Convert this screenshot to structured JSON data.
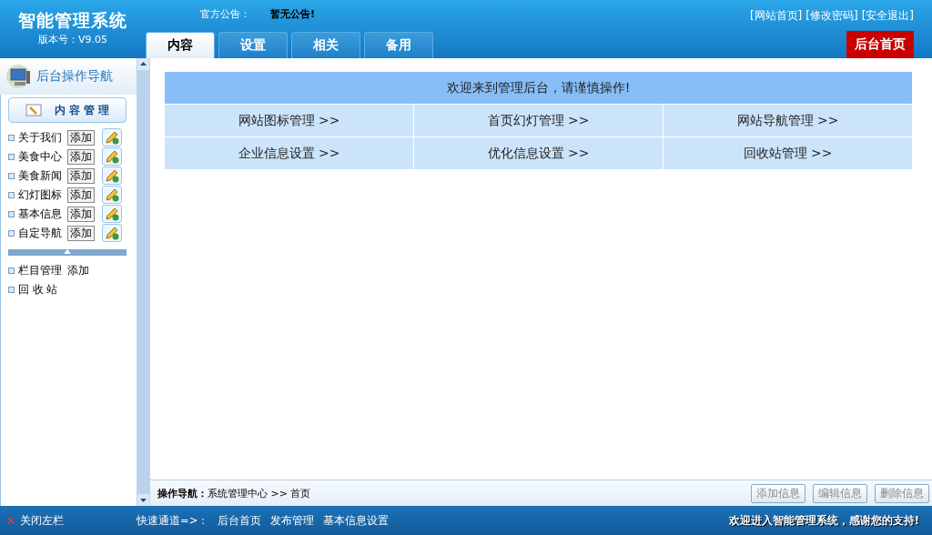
{
  "header": {
    "title": "智能管理系统",
    "version": "版本号：V9.05",
    "notice_label": "官方公告：",
    "notice": "暂无公告!",
    "links": [
      "[网站首页]",
      "[修改密码]",
      "[安全退出]"
    ],
    "home_button": "后台首页"
  },
  "tabs": [
    {
      "label": "内容",
      "selected": true
    },
    {
      "label": "设置",
      "selected": false
    },
    {
      "label": "相关",
      "selected": false
    },
    {
      "label": "备用",
      "selected": false
    }
  ],
  "sidebar": {
    "title": "后台操作导航",
    "section": "内 容 管 理",
    "items": [
      {
        "label": "关于我们",
        "action": "添加"
      },
      {
        "label": "美食中心",
        "action": "添加"
      },
      {
        "label": "美食新闻",
        "action": "添加"
      },
      {
        "label": "幻灯图标",
        "action": "添加"
      },
      {
        "label": "基本信息",
        "action": "添加"
      },
      {
        "label": "自定导航",
        "action": "添加"
      }
    ],
    "extra_items": [
      {
        "label": "栏目管理",
        "action": "添加"
      },
      {
        "label": "回 收 站"
      }
    ]
  },
  "welcome": "欢迎来到管理后台，请谨慎操作!",
  "shortcuts": [
    "网站图标管理 >>",
    "首页幻灯管理 >>",
    "网站导航管理 >>",
    "企业信息设置 >>",
    "优化信息设置 >>",
    "回收站管理 >>"
  ],
  "breadcrumb": {
    "label": "操作导航：",
    "path": "系统管理中心 >> 首页"
  },
  "actions": [
    "添加信息",
    "编辑信息",
    "删除信息"
  ],
  "footer": {
    "close": "关闭左栏",
    "quick_label": "快速通道=>：",
    "quick_links": [
      "后台首页",
      "发布管理",
      "基本信息设置"
    ],
    "message": "欢迎进入智能管理系统，感谢您的支持!"
  }
}
